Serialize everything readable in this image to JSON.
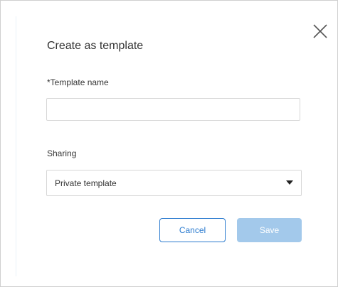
{
  "dialog": {
    "title": "Create as template",
    "close_icon": "close-icon"
  },
  "form": {
    "template_name": {
      "label": "*Template name",
      "value": "",
      "placeholder": ""
    },
    "sharing": {
      "label": "Sharing",
      "selected": "Private template",
      "dropdown_icon": "caret-down-icon"
    }
  },
  "actions": {
    "cancel_label": "Cancel",
    "save_label": "Save",
    "save_disabled": true
  },
  "colors": {
    "accent": "#2b7bcf",
    "save_disabled_bg": "#a3c9eb",
    "border": "#d7d7d7"
  }
}
